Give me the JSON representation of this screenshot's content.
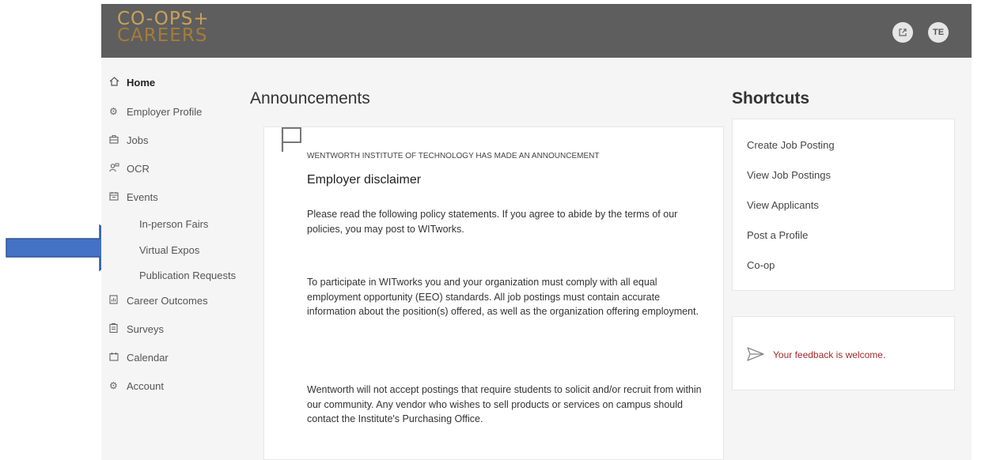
{
  "header": {
    "logo_line1": "CO-OPS+",
    "logo_line2": "CAREERS",
    "avatar_initials": "TE",
    "external_link_icon": "external-link-icon",
    "bg_color": "#5e5e5e",
    "logo_color": "#c9a25a"
  },
  "sidebar": {
    "items": [
      {
        "label": "Home",
        "icon": "home-icon"
      },
      {
        "label": "Employer Profile",
        "icon": "gear-icon"
      },
      {
        "label": "Jobs",
        "icon": "briefcase-icon"
      },
      {
        "label": "OCR",
        "icon": "people-icon"
      },
      {
        "label": "Events",
        "icon": "calendar-grid-icon"
      },
      {
        "label": "In-person Fairs"
      },
      {
        "label": "Virtual Expos"
      },
      {
        "label": "Publication Requests"
      },
      {
        "label": "Career Outcomes",
        "icon": "document-chart-icon"
      },
      {
        "label": "Surveys",
        "icon": "clipboard-icon"
      },
      {
        "label": "Calendar",
        "icon": "calendar-icon"
      },
      {
        "label": "Account",
        "icon": "gear-icon"
      }
    ]
  },
  "announcements": {
    "title": "Announcements",
    "from": "WENTWORTH INSTITUTE OF TECHNOLOGY HAS MADE AN ANNOUNCEMENT",
    "heading": "Employer disclaimer",
    "paragraphs": [
      "Please read the following policy statements. If you agree to abide by the terms of our policies, you may post to WITworks.",
      "To participate in WITworks you and your organization must comply with all equal employment opportunity (EEO) standards. All job postings must contain accurate information about the position(s) offered, as well as the organization offering employment.",
      "Wentworth will not accept postings that require students to solicit and/or recruit from within our community. Any vendor who wishes to sell products or services on campus should contact the Institute's Purchasing Office."
    ]
  },
  "shortcuts": {
    "title": "Shortcuts",
    "links": [
      "Create Job Posting",
      "View Job Postings",
      "View Applicants",
      "Post a Profile",
      "Co-op"
    ]
  },
  "feedback": {
    "text": "Your feedback is welcome.",
    "icon": "send-icon",
    "color": "#a02b2b"
  },
  "annotation": {
    "arrow_color": "#4472c4",
    "arrow_icon": "right-arrow-icon"
  }
}
